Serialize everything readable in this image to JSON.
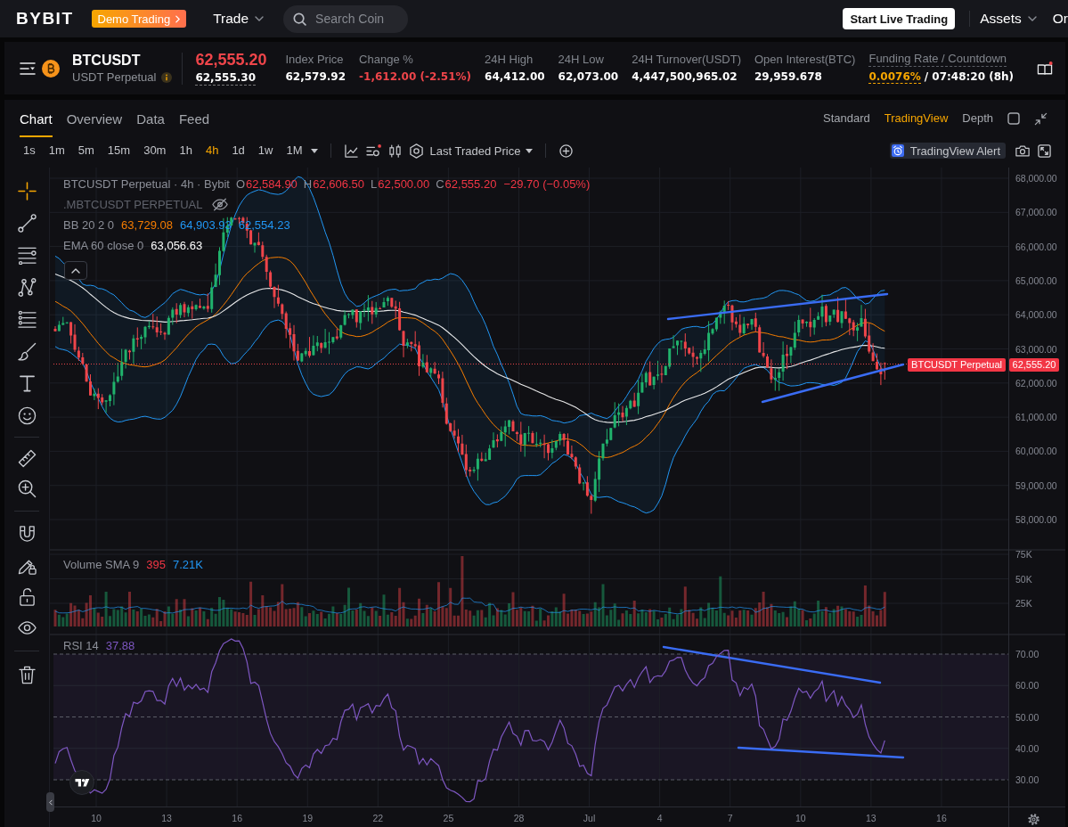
{
  "top_nav": {
    "logo": "BYBIT",
    "demo_button": "Demo Trading",
    "trade_menu": "Trade",
    "search": {
      "placeholder": "Search Coin"
    },
    "live_button": "Start Live Trading",
    "assets_menu": "Assets",
    "next_menu": "Or"
  },
  "ticker": {
    "symbol": "BTCUSDT",
    "contract": "USDT Perpetual",
    "last_price": {
      "value": "62,555.20",
      "falling": true
    },
    "mark_price": "62,555.30",
    "stats": [
      {
        "label": "Index Price",
        "value": "62,579.92",
        "falling": false
      },
      {
        "label": "Change %",
        "value": "-1,612.00 (-2.51%)",
        "falling": true
      },
      {
        "label": "24H High",
        "value": "64,412.00",
        "falling": false
      },
      {
        "label": "24H Low",
        "value": "62,073.00",
        "falling": false
      },
      {
        "label": "24H Turnover(USDT)",
        "value": "4,447,500,965.02",
        "falling": false
      },
      {
        "label": "Open Interest(BTC)",
        "value": "29,959.678",
        "falling": false
      }
    ],
    "funding": {
      "label": "Funding Rate / Countdown",
      "rate": "0.0076%",
      "countdown": "/ 07:48:20 (8h)"
    }
  },
  "chart_tabs": [
    {
      "label": "Chart",
      "selected": true
    },
    {
      "label": "Overview",
      "selected": false
    },
    {
      "label": "Data",
      "selected": false
    },
    {
      "label": "Feed",
      "selected": false
    }
  ],
  "chart_modes": [
    {
      "label": "Standard",
      "selected": false
    },
    {
      "label": "TradingView",
      "selected": true
    },
    {
      "label": "Depth",
      "selected": false
    }
  ],
  "toolbar": {
    "intervals": [
      {
        "label": "1s",
        "selected": false
      },
      {
        "label": "1m",
        "selected": false
      },
      {
        "label": "5m",
        "selected": false
      },
      {
        "label": "15m",
        "selected": false
      },
      {
        "label": "30m",
        "selected": false
      },
      {
        "label": "1h",
        "selected": false
      },
      {
        "label": "4h",
        "selected": true
      },
      {
        "label": "1d",
        "selected": false
      },
      {
        "label": "1w",
        "selected": false
      },
      {
        "label": "1M",
        "selected": false
      }
    ],
    "price_source": "Last Traded Price",
    "alert_button": "TradingView Alert"
  },
  "drawing_tool_groups": [
    {
      "tools": [
        {
          "kind": "crosshair",
          "selected": true
        },
        {
          "kind": "trendline",
          "selected": false
        },
        {
          "kind": "hlines",
          "selected": false
        },
        {
          "kind": "pattern",
          "selected": false
        },
        {
          "kind": "levels",
          "selected": false
        },
        {
          "kind": "brush",
          "selected": false
        },
        {
          "kind": "text",
          "selected": false
        },
        {
          "kind": "emoji",
          "selected": false
        }
      ]
    },
    {
      "tools": [
        {
          "kind": "ruler",
          "selected": false
        },
        {
          "kind": "zoom",
          "selected": false
        }
      ]
    },
    {
      "tools": [
        {
          "kind": "magnet",
          "selected": false
        },
        {
          "kind": "pencillock",
          "selected": false
        },
        {
          "kind": "padlock",
          "selected": false
        },
        {
          "kind": "eye",
          "selected": false
        }
      ]
    },
    {
      "tools": [
        {
          "kind": "trash",
          "selected": false
        }
      ]
    }
  ],
  "chart": {
    "legend": {
      "title": "BTCUSDT Perpetual · 4h · Bybit",
      "falling": true,
      "ohlc": [
        {
          "key": "O",
          "value": "62,584.90"
        },
        {
          "key": "H",
          "value": "62,606.50"
        },
        {
          "key": "L",
          "value": "62,500.00"
        },
        {
          "key": "C",
          "value": "62,555.20"
        }
      ],
      "change": "−29.70 (−0.05%)"
    },
    "overlay": {
      "name": ".MBTCUSDT PERPETUAL",
      "visible": false
    },
    "indicators": [
      {
        "name": "BB 20 2 0",
        "values": [
          {
            "text": "63,729.08",
            "color": "#f57c00"
          },
          {
            "text": "64,903.93",
            "color": "#2196f3"
          },
          {
            "text": "62,554.23",
            "color": "#2196f3"
          }
        ]
      },
      {
        "name": "EMA 60 close 0",
        "values": [
          {
            "text": "63,056.63",
            "color": "#ffffff"
          }
        ]
      }
    ],
    "volume_legend": {
      "name": "Volume SMA 9",
      "values": [
        {
          "text": "395",
          "color": "#f23645"
        },
        {
          "text": "7.21K",
          "color": "#2196f3"
        }
      ]
    },
    "rsi_legend": {
      "name": "RSI 14",
      "values": [
        {
          "text": "37.88",
          "color": "#7e57c2"
        }
      ]
    },
    "price_ticks": [
      "68,000.00",
      "67,000.00",
      "66,000.00",
      "65,000.00",
      "64,000.00",
      "63,000.00",
      "62,000.00",
      "61,000.00",
      "60,000.00",
      "59,000.00",
      "58,000.00"
    ],
    "volume_ticks": [
      "75K",
      "50K",
      "25K"
    ],
    "rsi_ticks": [
      "70.00",
      "60.00",
      "50.00",
      "40.00",
      "30.00"
    ],
    "time_ticks": [
      "10",
      "13",
      "16",
      "19",
      "22",
      "25",
      "28",
      "Jul",
      "4",
      "7",
      "10",
      "13",
      "16"
    ],
    "last_price_tag": {
      "symbol": "BTCUSDT Perpetual",
      "price": "62,555.20"
    }
  }
}
